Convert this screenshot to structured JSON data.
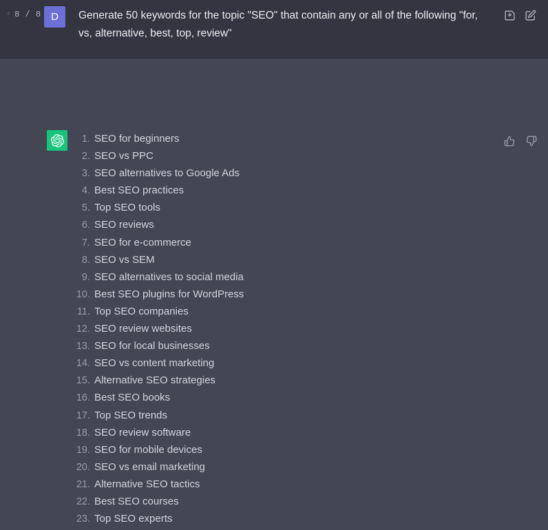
{
  "colors": {
    "prompt_bg": "#343541",
    "answer_bg": "#444654",
    "user_avatar": "#6c6fd6",
    "bot_avatar": "#19c37d",
    "text_primary": "#ececf1",
    "text_list": "#d1d5db",
    "text_muted": "#9a9aad",
    "icon": "#acacbe"
  },
  "prompt": {
    "pager": {
      "prev_glyph": "‹",
      "next_glyph": "›",
      "count": "8 / 8"
    },
    "avatar_initial": "D",
    "text": "Generate 50 keywords for the topic \"SEO\" that contain any or all of the following \"for, vs, alternative, best, top, review\"",
    "actions": [
      {
        "name": "save-icon",
        "title": "Save"
      },
      {
        "name": "edit-icon",
        "title": "Edit"
      }
    ]
  },
  "answer": {
    "avatar_icon": "openai-logo-icon",
    "actions": [
      {
        "name": "thumbs-up-icon",
        "title": "Good response"
      },
      {
        "name": "thumbs-down-icon",
        "title": "Bad response"
      }
    ],
    "list": [
      {
        "num": "1.",
        "text": "SEO for beginners"
      },
      {
        "num": "2.",
        "text": "SEO vs PPC"
      },
      {
        "num": "3.",
        "text": "SEO alternatives to Google Ads"
      },
      {
        "num": "4.",
        "text": "Best SEO practices"
      },
      {
        "num": "5.",
        "text": "Top SEO tools"
      },
      {
        "num": "6.",
        "text": "SEO reviews"
      },
      {
        "num": "7.",
        "text": "SEO for e-commerce"
      },
      {
        "num": "8.",
        "text": "SEO vs SEM"
      },
      {
        "num": "9.",
        "text": "SEO alternatives to social media"
      },
      {
        "num": "10.",
        "text": "Best SEO plugins for WordPress"
      },
      {
        "num": "11.",
        "text": "Top SEO companies"
      },
      {
        "num": "12.",
        "text": "SEO review websites"
      },
      {
        "num": "13.",
        "text": "SEO for local businesses"
      },
      {
        "num": "14.",
        "text": "SEO vs content marketing"
      },
      {
        "num": "15.",
        "text": "Alternative SEO strategies"
      },
      {
        "num": "16.",
        "text": "Best SEO books"
      },
      {
        "num": "17.",
        "text": "Top SEO trends"
      },
      {
        "num": "18.",
        "text": "SEO review software"
      },
      {
        "num": "19.",
        "text": "SEO for mobile devices"
      },
      {
        "num": "20.",
        "text": "SEO vs email marketing"
      },
      {
        "num": "21.",
        "text": "Alternative SEO tactics"
      },
      {
        "num": "22.",
        "text": "Best SEO courses"
      },
      {
        "num": "23.",
        "text": "Top SEO experts"
      }
    ]
  }
}
